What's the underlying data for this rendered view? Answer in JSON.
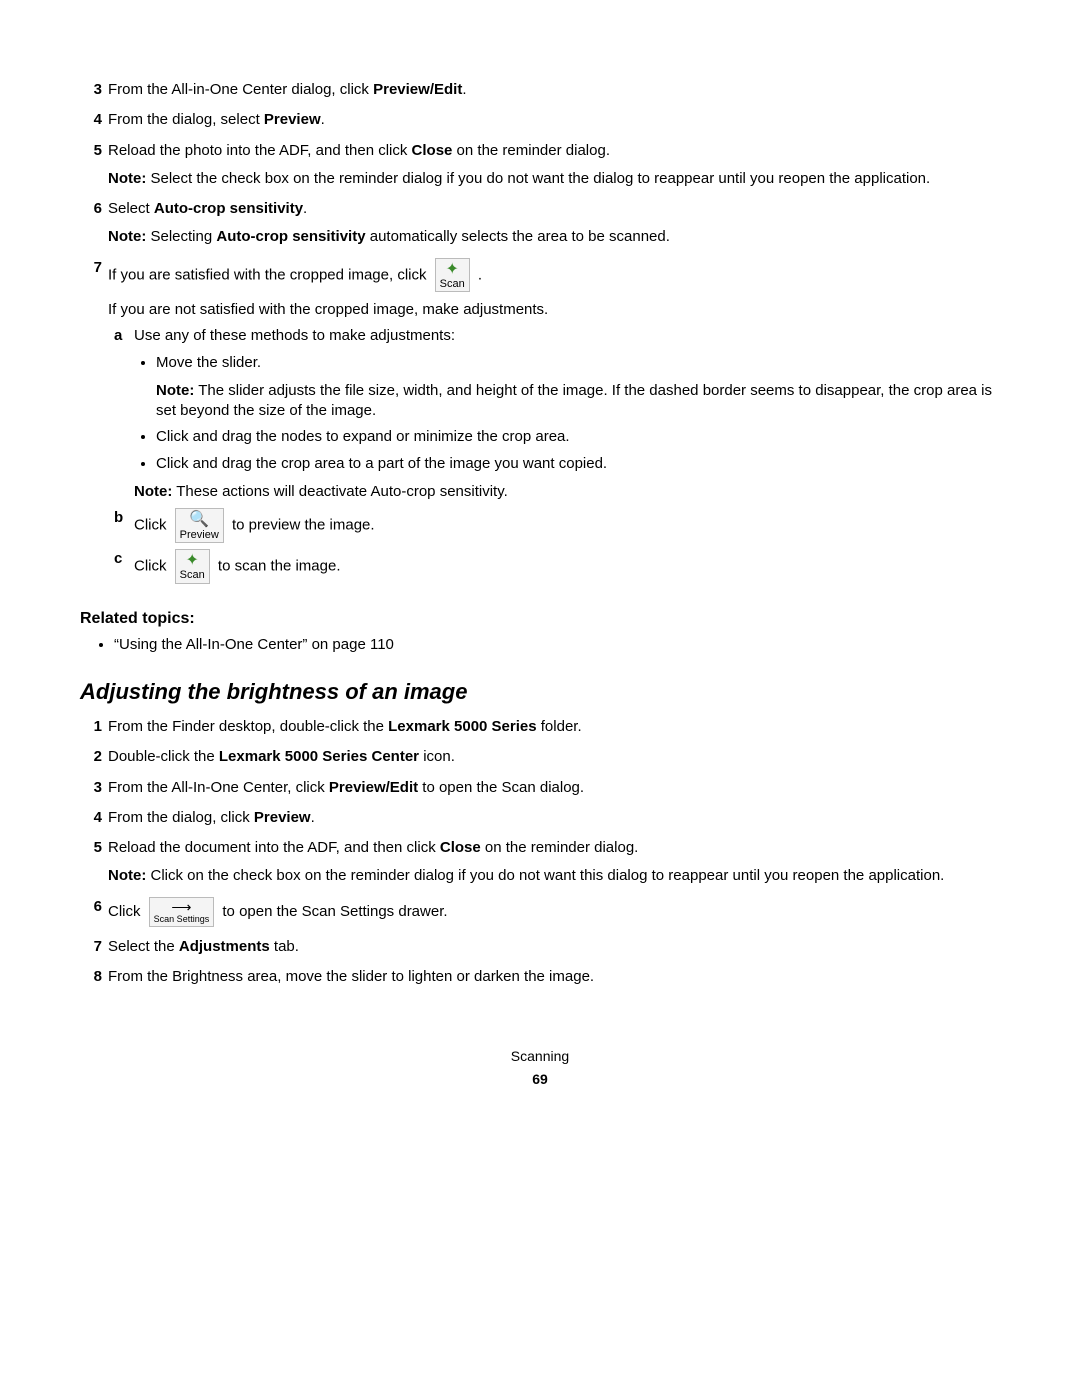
{
  "icons": {
    "scan": {
      "glyph": "✦",
      "label": "Scan"
    },
    "preview": {
      "glyph": "🔍",
      "label": "Preview"
    },
    "scan_settings": {
      "glyph": "⟶",
      "label": "Scan Settings"
    }
  },
  "topSteps": {
    "s3": {
      "num": "3",
      "pre": "From the All-in-One Center dialog, click ",
      "bold": "Preview/Edit",
      "post": "."
    },
    "s4": {
      "num": "4",
      "pre": "From the dialog, select ",
      "bold": "Preview",
      "post": "."
    },
    "s5": {
      "num": "5",
      "pre": "Reload the photo into the ADF, and then click ",
      "bold": "Close",
      "post": " on the reminder dialog.",
      "note_label": "Note:",
      "note_body": " Select the check box on the reminder dialog if you do not want the dialog to reappear until you reopen the application."
    },
    "s6": {
      "num": "6",
      "pre": "Select ",
      "bold": "Auto-crop sensitivity",
      "post": ".",
      "note_label": "Note:",
      "note_pre": " Selecting ",
      "note_bold": "Auto-crop sensitivity",
      "note_post": " automatically selects the area to be scanned."
    },
    "s7": {
      "num": "7",
      "line1_pre": "If you are satisfied with the cropped image, click ",
      "line1_post": ".",
      "line2": "If you are not satisfied with the cropped image, make adjustments.",
      "a": {
        "letter": "a",
        "text": "Use any of these methods to make adjustments:",
        "bul1": "Move the slider.",
        "bul1_note_label": "Note:",
        "bul1_note": " The slider adjusts the file size, width, and height of the image. If the dashed border seems to disappear, the crop area is set beyond the size of the image.",
        "bul2": "Click and drag the nodes to expand or minimize the crop area.",
        "bul3": "Click and drag the crop area to a part of the image you want copied.",
        "note2_label": "Note:",
        "note2": " These actions will deactivate Auto-crop sensitivity."
      },
      "b": {
        "letter": "b",
        "pre": "Click ",
        "post": " to preview the image."
      },
      "c": {
        "letter": "c",
        "pre": "Click ",
        "post": " to scan the image."
      }
    }
  },
  "related": {
    "heading": "Related topics:",
    "item": "“Using the All-In-One Center” on page 110"
  },
  "section2": {
    "heading": "Adjusting the brightness of an image",
    "s1": {
      "num": "1",
      "pre": "From the Finder desktop, double-click the ",
      "bold": "Lexmark 5000 Series",
      "post": " folder."
    },
    "s2": {
      "num": "2",
      "pre": "Double-click the ",
      "bold": "Lexmark 5000 Series Center",
      "post": " icon."
    },
    "s3": {
      "num": "3",
      "pre": "From the All-In-One Center, click ",
      "bold": "Preview/Edit",
      "post": " to open the Scan dialog."
    },
    "s4": {
      "num": "4",
      "pre": "From the dialog, click ",
      "bold": "Preview",
      "post": "."
    },
    "s5": {
      "num": "5",
      "pre": "Reload the document into the ADF, and then click ",
      "bold": "Close",
      "post": " on the reminder dialog.",
      "note_label": "Note:",
      "note_body": " Click on the check box on the reminder dialog if you do not want this dialog to reappear until you reopen the application."
    },
    "s6": {
      "num": "6",
      "pre": "Click ",
      "post": " to open the Scan Settings drawer."
    },
    "s7": {
      "num": "7",
      "pre": "Select the ",
      "bold": "Adjustments",
      "post": " tab."
    },
    "s8": {
      "num": "8",
      "text": "From the Brightness area, move the slider to lighten or darken the image."
    }
  },
  "footer": {
    "chapter": "Scanning",
    "page": "69"
  }
}
